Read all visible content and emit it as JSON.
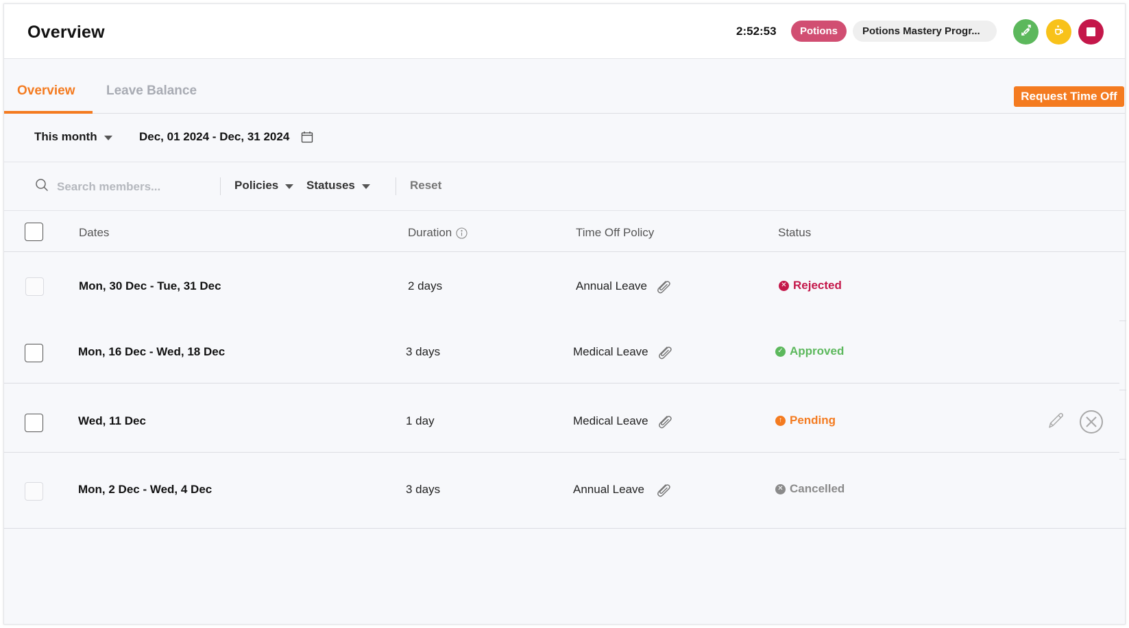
{
  "header": {
    "title": "Overview",
    "timer": "2:52:53",
    "project_badge": "Potions",
    "task_pill": "Potions Mastery Progr...",
    "buttons": [
      {
        "name": "switch-task",
        "icon": "tag-swap-icon",
        "color": "#5cb85c"
      },
      {
        "name": "break",
        "icon": "coffee-cup-icon",
        "color": "#f8c21a"
      },
      {
        "name": "stop-timer",
        "icon": "stop-icon",
        "color": "#c4174a"
      }
    ]
  },
  "tabs": [
    {
      "label": "Overview",
      "active": true
    },
    {
      "label": "Leave Balance",
      "active": false
    }
  ],
  "actions": {
    "request_time_off": "Request Time Off"
  },
  "date_filter": {
    "range_option": "This month",
    "date_range": "Dec, 01 2024 - Dec, 31 2024"
  },
  "filters": {
    "search_placeholder": "Search members...",
    "search_value": "",
    "policies_label": "Policies",
    "statuses_label": "Statuses",
    "reset_label": "Reset"
  },
  "table": {
    "columns": {
      "dates": "Dates",
      "duration": "Duration",
      "policy": "Time Off Policy",
      "status": "Status"
    },
    "rows": [
      {
        "dates": "Mon, 30 Dec - Tue, 31 Dec",
        "duration": "2 days",
        "policy": "Annual Leave",
        "status": "Rejected",
        "status_color": "#c4174a",
        "selectable": false,
        "editable": false
      },
      {
        "dates": "Mon, 16 Dec - Wed, 18 Dec",
        "duration": "3 days",
        "policy": "Medical Leave",
        "status": "Approved",
        "status_color": "#5cb85c",
        "selectable": true,
        "editable": false
      },
      {
        "dates": "Wed, 11 Dec",
        "duration": "1 day",
        "policy": "Medical Leave",
        "status": "Pending",
        "status_color": "#f47b20",
        "selectable": true,
        "editable": true
      },
      {
        "dates": "Mon, 2 Dec - Wed, 4 Dec",
        "duration": "3 days",
        "policy": "Annual Leave",
        "status": "Cancelled",
        "status_color": "#8a8a8a",
        "selectable": false,
        "editable": false
      }
    ]
  },
  "colors": {
    "accent": "#f47b20",
    "rejected": "#c4174a",
    "approved": "#5cb85c",
    "pending": "#f47b20",
    "cancelled": "#8a8a8a"
  }
}
